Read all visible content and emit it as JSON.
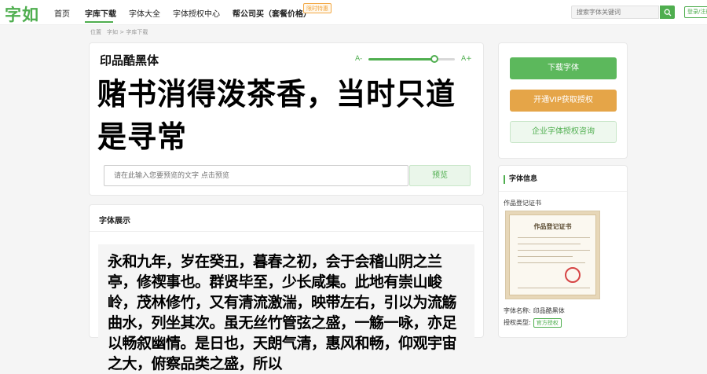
{
  "header": {
    "logo": "字如",
    "nav": [
      "首页",
      "字库下载",
      "字体大全",
      "字体授权中心",
      "帮公司买（套餐价格）"
    ],
    "badge": "限时特惠",
    "search_placeholder": "搜索字体关键词",
    "login_label": "登录/注册"
  },
  "breadcrumb": "位置　字如 > 字库下载",
  "preview": {
    "font_name": "印品酷黑体",
    "size_minus": "A-",
    "size_plus": "A+",
    "size_level": 0.9,
    "sample_text": "赌书消得泼茶香，当时只道是寻常",
    "input_placeholder": "请在此输入您要预览的文字 点击预览",
    "preview_button": "预览"
  },
  "showcase": {
    "title": "字体展示",
    "text": "永和九年，岁在癸丑，暮春之初，会于会稽山阴之兰亭，修禊事也。群贤毕至，少长咸集。此地有崇山峻岭，茂林修竹，又有清流激湍，映带左右，引以为流觞曲水，列坐其次。虽无丝竹管弦之盛，一觞一咏，亦足以畅叙幽情。是日也，天朗气清，惠风和畅，仰观宇宙之大，俯察品类之盛，所以"
  },
  "actions": {
    "download": "下载字体",
    "vip": "开通VIP获取授权",
    "business": "企业字体授权咨询"
  },
  "info": {
    "title": "字体信息",
    "cert_label": "作品登记证书",
    "cert_heading": "作品登记证书",
    "name_label": "字体名称:",
    "name_value": "印品酷黑体",
    "license_label": "授权类型:",
    "license_value": "官方授权"
  },
  "colors": {
    "brand_green": "#4fae4f",
    "vip_orange": "#e5a548"
  }
}
